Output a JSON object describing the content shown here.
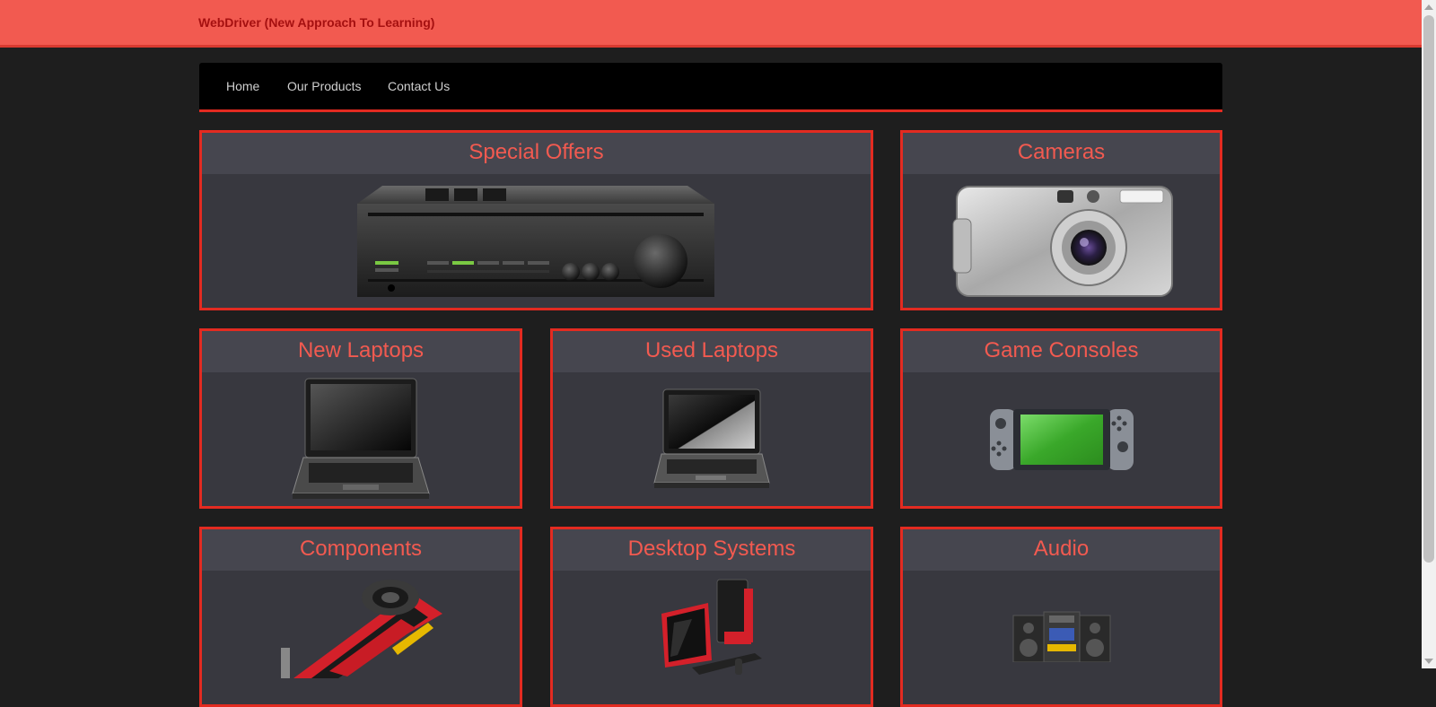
{
  "header": {
    "brand": "WebDriver (New Approach To Learning)"
  },
  "nav": {
    "items": [
      "Home",
      "Our Products",
      "Contact Us"
    ]
  },
  "products": [
    {
      "title": "Special Offers",
      "icon": "amplifier-icon"
    },
    {
      "title": "Cameras",
      "icon": "camera-icon"
    },
    {
      "title": "New Laptops",
      "icon": "laptop-icon"
    },
    {
      "title": "Used Laptops",
      "icon": "laptop-icon"
    },
    {
      "title": "Game Consoles",
      "icon": "game-console-icon"
    },
    {
      "title": "Components",
      "icon": "graphics-card-icon"
    },
    {
      "title": "Desktop Systems",
      "icon": "desktop-system-icon"
    },
    {
      "title": "Audio",
      "icon": "stereo-icon"
    }
  ],
  "colors": {
    "header": "#f25a50",
    "accent": "#e32b21",
    "brand_text": "#a51010",
    "card_bg": "#38383f"
  }
}
